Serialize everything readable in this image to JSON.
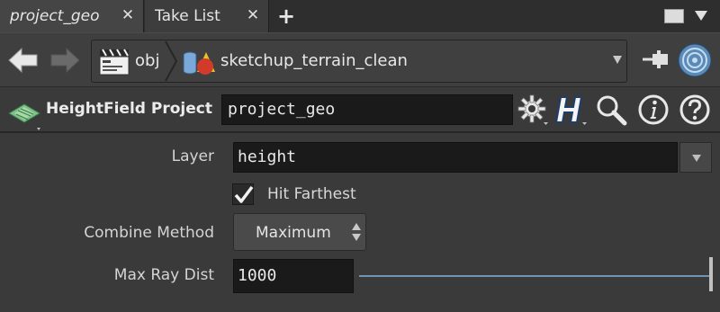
{
  "tabs": [
    {
      "label": "project_geo",
      "active": true
    },
    {
      "label": "Take List",
      "active": false
    }
  ],
  "path": {
    "crumbs": [
      "obj",
      "sketchup_terrain_clean"
    ]
  },
  "node": {
    "type_label": "HeightField Project",
    "name": "project_geo"
  },
  "params": {
    "layer": {
      "label": "Layer",
      "value": "height"
    },
    "hit_farthest": {
      "label": "Hit Farthest",
      "checked": true
    },
    "combine_method": {
      "label": "Combine Method",
      "value": "Maximum"
    },
    "max_ray_dist": {
      "label": "Max Ray Dist",
      "value": "1000"
    }
  },
  "icons": {
    "tab_close": "close-icon",
    "add_tab": "plus-icon",
    "back": "arrow-left-icon",
    "forward": "arrow-right-icon",
    "obj": "clapperboard-icon",
    "geo": "geometry-shapes-icon",
    "pin": "pin-icon",
    "link": "link-target-icon",
    "node_type": "heightfield-icon",
    "gear": "gear-icon",
    "houdini": "houdini-h-icon",
    "search": "search-icon",
    "info": "info-icon",
    "help": "help-icon"
  },
  "colors": {
    "slider_track": "#6f95b3",
    "accent_geo_red": "#d23a2a",
    "accent_geo_yellow": "#e8c02a",
    "accent_geo_blue": "#7aa8d8"
  }
}
